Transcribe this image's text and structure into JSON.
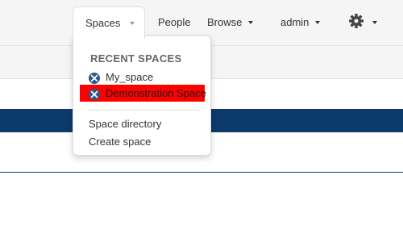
{
  "nav": {
    "spaces_label": "Spaces",
    "people_label": "People",
    "browse_label": "Browse",
    "user_label": "admin",
    "settings_icon": "gear-icon"
  },
  "dropdown": {
    "heading": "RECENT SPACES",
    "recent_spaces": [
      {
        "label": "My_space",
        "icon": "space-avatar-icon",
        "highlighted": false
      },
      {
        "label": "Demonstration Space",
        "icon": "space-avatar-icon",
        "highlighted": true
      }
    ],
    "links": [
      {
        "label": "Space directory"
      },
      {
        "label": "Create space"
      }
    ]
  },
  "colors": {
    "highlight": "#ff0000",
    "band": "#0b3a6b",
    "space_icon_bg": "#2f5a86"
  }
}
